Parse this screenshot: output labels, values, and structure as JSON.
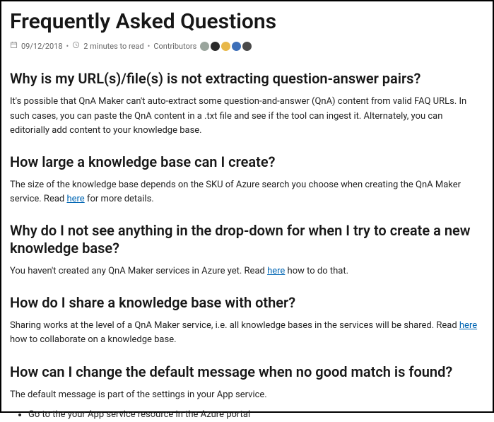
{
  "title": "Frequently Asked Questions",
  "meta": {
    "date": "09/12/2018",
    "read_time": "2 minutes to read",
    "contributors_label": "Contributors",
    "avatar_colors": [
      "#9aa59d",
      "#2b2b2b",
      "#e8b84a",
      "#3d6fb8",
      "#4a4a4a"
    ]
  },
  "sections": [
    {
      "heading": "Why is my URL(s)/file(s) is not extracting question-answer pairs?",
      "body_pre": "It's possible that QnA Maker can't auto-extract some question-and-answer (QnA) content from valid FAQ URLs. In such cases, you can paste the QnA content in a .txt file and see if the tool can ingest it. Alternately, you can editorially add content to your knowledge base.",
      "link_text": "",
      "body_post": ""
    },
    {
      "heading": "How large a knowledge base can I create?",
      "body_pre": "The size of the knowledge base depends on the SKU of Azure search you choose when creating the QnA Maker service. Read ",
      "link_text": "here",
      "body_post": " for more details."
    },
    {
      "heading": "Why do I not see anything in the drop-down for when I try to create a new knowledge base?",
      "body_pre": "You haven't created any QnA Maker services in Azure yet. Read ",
      "link_text": "here",
      "body_post": " how to do that."
    },
    {
      "heading": "How do I share a knowledge base with other?",
      "body_pre": "Sharing works at the level of a QnA Maker service, i.e. all knowledge bases in the services will be shared. Read ",
      "link_text": "here",
      "body_post": " how to collaborate on a knowledge base."
    },
    {
      "heading": "How can I change the default message when no good match is found?",
      "body_pre": "The default message is part of the settings in your App service.",
      "link_text": "",
      "body_post": "",
      "bullets": [
        "Go to the your App service resource in the Azure portal"
      ]
    }
  ]
}
